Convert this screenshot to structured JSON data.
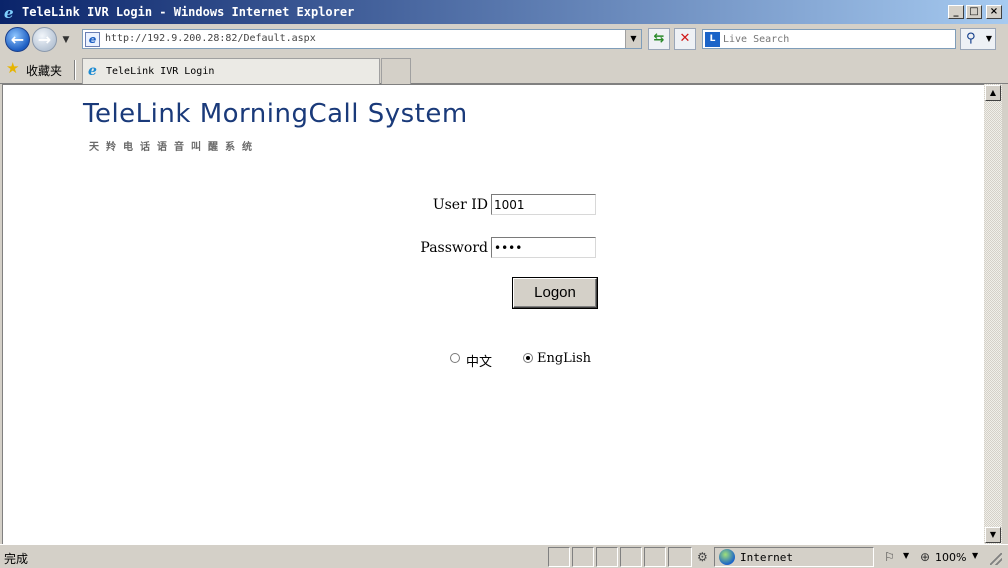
{
  "window": {
    "title": "TeleLink IVR Login - Windows Internet Explorer",
    "app_icon": "ie-logo-icon",
    "controls": [
      "minimize-icon",
      "maximize-icon",
      "close-icon"
    ]
  },
  "address_bar": {
    "url": "http://192.9.200.28:82/Default.aspx",
    "search_placeholder": "Live Search"
  },
  "favorites": {
    "label": "收藏夹"
  },
  "tabs": [
    {
      "label": "TeleLink IVR Login",
      "active": true
    }
  ],
  "page": {
    "logo_title": "TeleLink MorningCall System",
    "logo_subtitle": "天羚电话语音叫醒系统",
    "form": {
      "userid_label": "User ID",
      "userid_value": "1001",
      "password_label": "Password",
      "password_value": "••••",
      "logon_label": "Logon"
    },
    "language": {
      "options": [
        {
          "label": "中文",
          "selected": false
        },
        {
          "label": "EngLish",
          "selected": true
        }
      ]
    }
  },
  "status_bar": {
    "status_text": "完成",
    "zone": "Internet",
    "zoom": "100%"
  },
  "colors": {
    "title_gradient_start": "#0a246a",
    "title_gradient_end": "#a6caf0",
    "logo_text": "#1a3a7a",
    "chrome": "#d4d0c8"
  }
}
